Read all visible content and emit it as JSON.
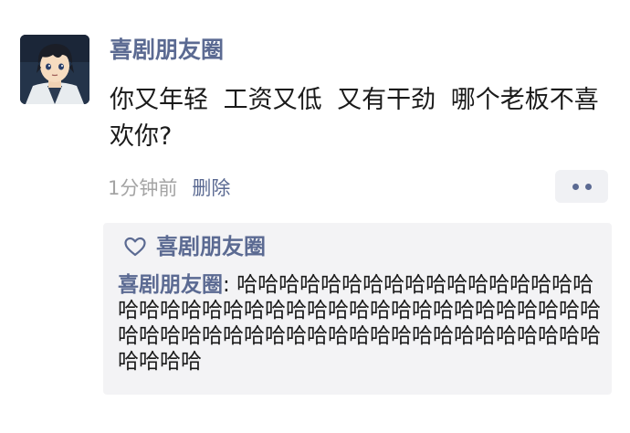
{
  "post": {
    "username": "喜剧朋友圈",
    "content": "你又年轻  工资又低  又有干劲  哪个老板不喜欢你?",
    "time": "1分钟前",
    "delete_label": "删除"
  },
  "icons": {
    "more": "more-dots-icon",
    "like": "heart-outline-icon"
  },
  "likes": {
    "names": "喜剧朋友圈"
  },
  "comments": [
    {
      "author": "喜剧朋友圈",
      "separator": ": ",
      "text": "哈哈哈哈哈哈哈哈哈哈哈哈哈哈哈哈哈哈哈哈哈哈哈哈哈哈哈哈哈哈哈哈哈哈哈哈哈哈哈哈哈哈哈哈哈哈哈哈哈哈哈哈哈哈哈哈哈哈哈哈哈哈哈哈哈哈哈"
    }
  ],
  "colors": {
    "link": "#5b6a92",
    "text": "#1a1a1a",
    "muted": "#a4a4a4",
    "panel": "#f3f3f5"
  }
}
